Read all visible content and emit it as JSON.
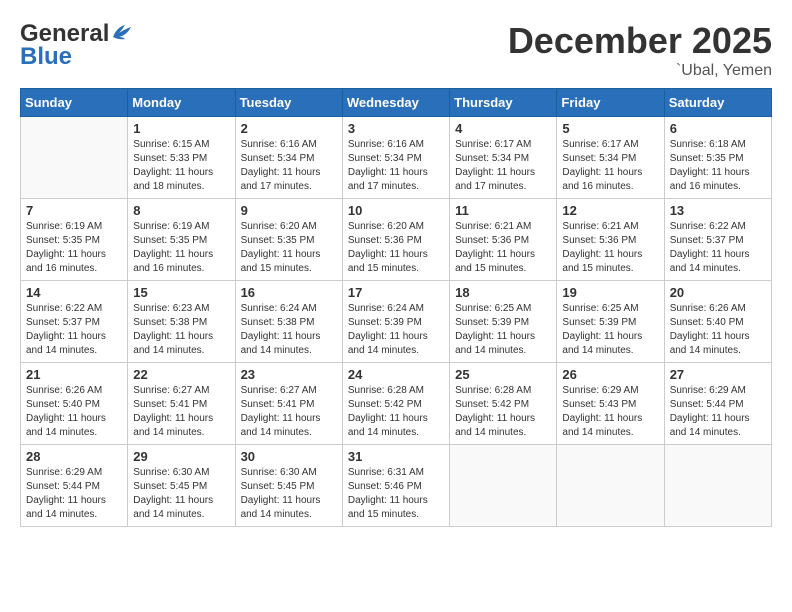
{
  "header": {
    "logo_general": "General",
    "logo_blue": "Blue",
    "month_title": "December 2025",
    "location": "`Ubal, Yemen"
  },
  "days_of_week": [
    "Sunday",
    "Monday",
    "Tuesday",
    "Wednesday",
    "Thursday",
    "Friday",
    "Saturday"
  ],
  "weeks": [
    [
      {
        "day": "",
        "info": ""
      },
      {
        "day": "1",
        "info": "Sunrise: 6:15 AM\nSunset: 5:33 PM\nDaylight: 11 hours\nand 18 minutes."
      },
      {
        "day": "2",
        "info": "Sunrise: 6:16 AM\nSunset: 5:34 PM\nDaylight: 11 hours\nand 17 minutes."
      },
      {
        "day": "3",
        "info": "Sunrise: 6:16 AM\nSunset: 5:34 PM\nDaylight: 11 hours\nand 17 minutes."
      },
      {
        "day": "4",
        "info": "Sunrise: 6:17 AM\nSunset: 5:34 PM\nDaylight: 11 hours\nand 17 minutes."
      },
      {
        "day": "5",
        "info": "Sunrise: 6:17 AM\nSunset: 5:34 PM\nDaylight: 11 hours\nand 16 minutes."
      },
      {
        "day": "6",
        "info": "Sunrise: 6:18 AM\nSunset: 5:35 PM\nDaylight: 11 hours\nand 16 minutes."
      }
    ],
    [
      {
        "day": "7",
        "info": "Sunrise: 6:19 AM\nSunset: 5:35 PM\nDaylight: 11 hours\nand 16 minutes."
      },
      {
        "day": "8",
        "info": "Sunrise: 6:19 AM\nSunset: 5:35 PM\nDaylight: 11 hours\nand 16 minutes."
      },
      {
        "day": "9",
        "info": "Sunrise: 6:20 AM\nSunset: 5:35 PM\nDaylight: 11 hours\nand 15 minutes."
      },
      {
        "day": "10",
        "info": "Sunrise: 6:20 AM\nSunset: 5:36 PM\nDaylight: 11 hours\nand 15 minutes."
      },
      {
        "day": "11",
        "info": "Sunrise: 6:21 AM\nSunset: 5:36 PM\nDaylight: 11 hours\nand 15 minutes."
      },
      {
        "day": "12",
        "info": "Sunrise: 6:21 AM\nSunset: 5:36 PM\nDaylight: 11 hours\nand 15 minutes."
      },
      {
        "day": "13",
        "info": "Sunrise: 6:22 AM\nSunset: 5:37 PM\nDaylight: 11 hours\nand 14 minutes."
      }
    ],
    [
      {
        "day": "14",
        "info": "Sunrise: 6:22 AM\nSunset: 5:37 PM\nDaylight: 11 hours\nand 14 minutes."
      },
      {
        "day": "15",
        "info": "Sunrise: 6:23 AM\nSunset: 5:38 PM\nDaylight: 11 hours\nand 14 minutes."
      },
      {
        "day": "16",
        "info": "Sunrise: 6:24 AM\nSunset: 5:38 PM\nDaylight: 11 hours\nand 14 minutes."
      },
      {
        "day": "17",
        "info": "Sunrise: 6:24 AM\nSunset: 5:39 PM\nDaylight: 11 hours\nand 14 minutes."
      },
      {
        "day": "18",
        "info": "Sunrise: 6:25 AM\nSunset: 5:39 PM\nDaylight: 11 hours\nand 14 minutes."
      },
      {
        "day": "19",
        "info": "Sunrise: 6:25 AM\nSunset: 5:39 PM\nDaylight: 11 hours\nand 14 minutes."
      },
      {
        "day": "20",
        "info": "Sunrise: 6:26 AM\nSunset: 5:40 PM\nDaylight: 11 hours\nand 14 minutes."
      }
    ],
    [
      {
        "day": "21",
        "info": "Sunrise: 6:26 AM\nSunset: 5:40 PM\nDaylight: 11 hours\nand 14 minutes."
      },
      {
        "day": "22",
        "info": "Sunrise: 6:27 AM\nSunset: 5:41 PM\nDaylight: 11 hours\nand 14 minutes."
      },
      {
        "day": "23",
        "info": "Sunrise: 6:27 AM\nSunset: 5:41 PM\nDaylight: 11 hours\nand 14 minutes."
      },
      {
        "day": "24",
        "info": "Sunrise: 6:28 AM\nSunset: 5:42 PM\nDaylight: 11 hours\nand 14 minutes."
      },
      {
        "day": "25",
        "info": "Sunrise: 6:28 AM\nSunset: 5:42 PM\nDaylight: 11 hours\nand 14 minutes."
      },
      {
        "day": "26",
        "info": "Sunrise: 6:29 AM\nSunset: 5:43 PM\nDaylight: 11 hours\nand 14 minutes."
      },
      {
        "day": "27",
        "info": "Sunrise: 6:29 AM\nSunset: 5:44 PM\nDaylight: 11 hours\nand 14 minutes."
      }
    ],
    [
      {
        "day": "28",
        "info": "Sunrise: 6:29 AM\nSunset: 5:44 PM\nDaylight: 11 hours\nand 14 minutes."
      },
      {
        "day": "29",
        "info": "Sunrise: 6:30 AM\nSunset: 5:45 PM\nDaylight: 11 hours\nand 14 minutes."
      },
      {
        "day": "30",
        "info": "Sunrise: 6:30 AM\nSunset: 5:45 PM\nDaylight: 11 hours\nand 14 minutes."
      },
      {
        "day": "31",
        "info": "Sunrise: 6:31 AM\nSunset: 5:46 PM\nDaylight: 11 hours\nand 15 minutes."
      },
      {
        "day": "",
        "info": ""
      },
      {
        "day": "",
        "info": ""
      },
      {
        "day": "",
        "info": ""
      }
    ]
  ]
}
